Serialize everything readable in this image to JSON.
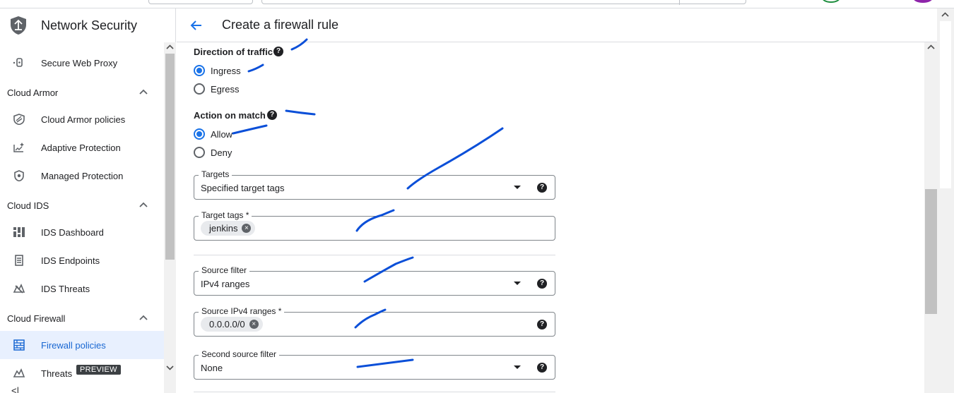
{
  "app": {
    "title": "Network Security"
  },
  "sidebar": {
    "items": [
      {
        "label": "Secure Web Proxy",
        "icon": "proxy-icon"
      },
      {
        "section": "Cloud Armor"
      },
      {
        "label": "Cloud Armor policies",
        "icon": "shield-icon"
      },
      {
        "label": "Adaptive Protection",
        "icon": "chart-sparkle-icon"
      },
      {
        "label": "Managed Protection",
        "icon": "shield-badge-icon"
      },
      {
        "section": "Cloud IDS"
      },
      {
        "label": "IDS Dashboard",
        "icon": "dashboard-icon"
      },
      {
        "label": "IDS Endpoints",
        "icon": "endpoints-icon"
      },
      {
        "label": "IDS Threats",
        "icon": "threats-icon"
      },
      {
        "section": "Cloud Firewall"
      },
      {
        "label": "Firewall policies",
        "icon": "firewall-icon",
        "active": true
      },
      {
        "label": "Threats",
        "icon": "threats-icon",
        "badge": "PREVIEW"
      }
    ],
    "collapse_label": "<|"
  },
  "header": {
    "title": "Create a firewall rule"
  },
  "form": {
    "direction": {
      "label": "Direction of traffic",
      "options": [
        "Ingress",
        "Egress"
      ],
      "selected": "Ingress"
    },
    "action": {
      "label": "Action on match",
      "options": [
        "Allow",
        "Deny"
      ],
      "selected": "Allow"
    },
    "targets": {
      "label": "Targets",
      "value": "Specified target tags"
    },
    "target_tags": {
      "label": "Target tags *",
      "chips": [
        "jenkins"
      ]
    },
    "source_filter": {
      "label": "Source filter",
      "value": "IPv4 ranges"
    },
    "source_ranges": {
      "label": "Source IPv4 ranges *",
      "chips": [
        "0.0.0.0/0"
      ]
    },
    "second_source_filter": {
      "label": "Second source filter",
      "value": "None"
    }
  },
  "colors": {
    "accent": "#1a73e8",
    "active_bg": "#e8f0fe",
    "annotation": "#0b4fd8"
  }
}
